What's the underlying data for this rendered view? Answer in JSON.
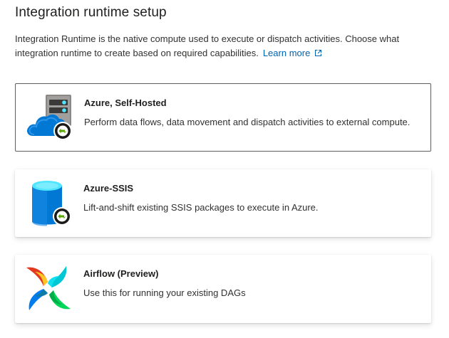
{
  "header": {
    "title": "Integration runtime setup",
    "description": "Integration Runtime is the native compute used to execute or dispatch activities. Choose what integration runtime to create based on required capabilities.",
    "learn_more_label": "Learn more"
  },
  "options": [
    {
      "title": "Azure, Self-Hosted",
      "description": "Perform data flows, data movement and dispatch activities to external compute.",
      "icon": "server-cloud-icon",
      "selected": true
    },
    {
      "title": "Azure-SSIS",
      "description": "Lift-and-shift existing SSIS packages to execute in Azure.",
      "icon": "database-icon",
      "selected": false
    },
    {
      "title": "Airflow (Preview)",
      "description": "Use this for running your existing DAGs",
      "icon": "airflow-pinwheel-icon",
      "selected": false
    }
  ],
  "colors": {
    "link": "#0063b1",
    "selected_border": "#605e5c",
    "azure_blue": "#0078d4",
    "runtime_badge_green": "#5ea0ef"
  }
}
